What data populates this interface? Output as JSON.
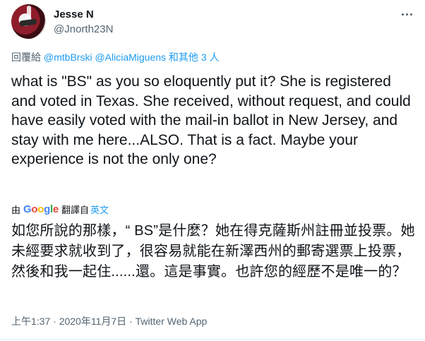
{
  "author": {
    "name": "Jesse N",
    "handle": "@Jnorth23N"
  },
  "reply": {
    "prefix": "回覆給 ",
    "user1": "@mtbBrski",
    "user2": "@AliciaMiguens",
    "suffix": " 和其他 3 人"
  },
  "tweet": {
    "text": "what is \"BS\" as you so eloquently put it?  She is registered and voted in Texas.  She received, without request, and could have easily voted with the mail-in ballot in New Jersey, and stay with me here...ALSO. That is a fact.  Maybe your experience is not the only one?"
  },
  "translation": {
    "by": "由",
    "google": {
      "g1": "G",
      "o1": "o",
      "o2": "o",
      "g2": "g",
      "l": "l",
      "e": "e"
    },
    "translated_from": "翻譯自",
    "language": "英文",
    "text": "如您所說的那樣，“ BS”是什麼？她在得克薩斯州註冊並投票。她未經要求就收到了，很容易就能在新澤西州的郵寄選票上投票，然後和我一起住......還。這是事實。也許您的經歷不是唯一的？"
  },
  "meta": {
    "time": "上午1:37",
    "sep1": " · ",
    "date": "2020年11月7日",
    "sep2": " · ",
    "source": "Twitter Web App"
  },
  "icons": {
    "avatar": "helmet-avatar",
    "more": "more-options-icon"
  }
}
